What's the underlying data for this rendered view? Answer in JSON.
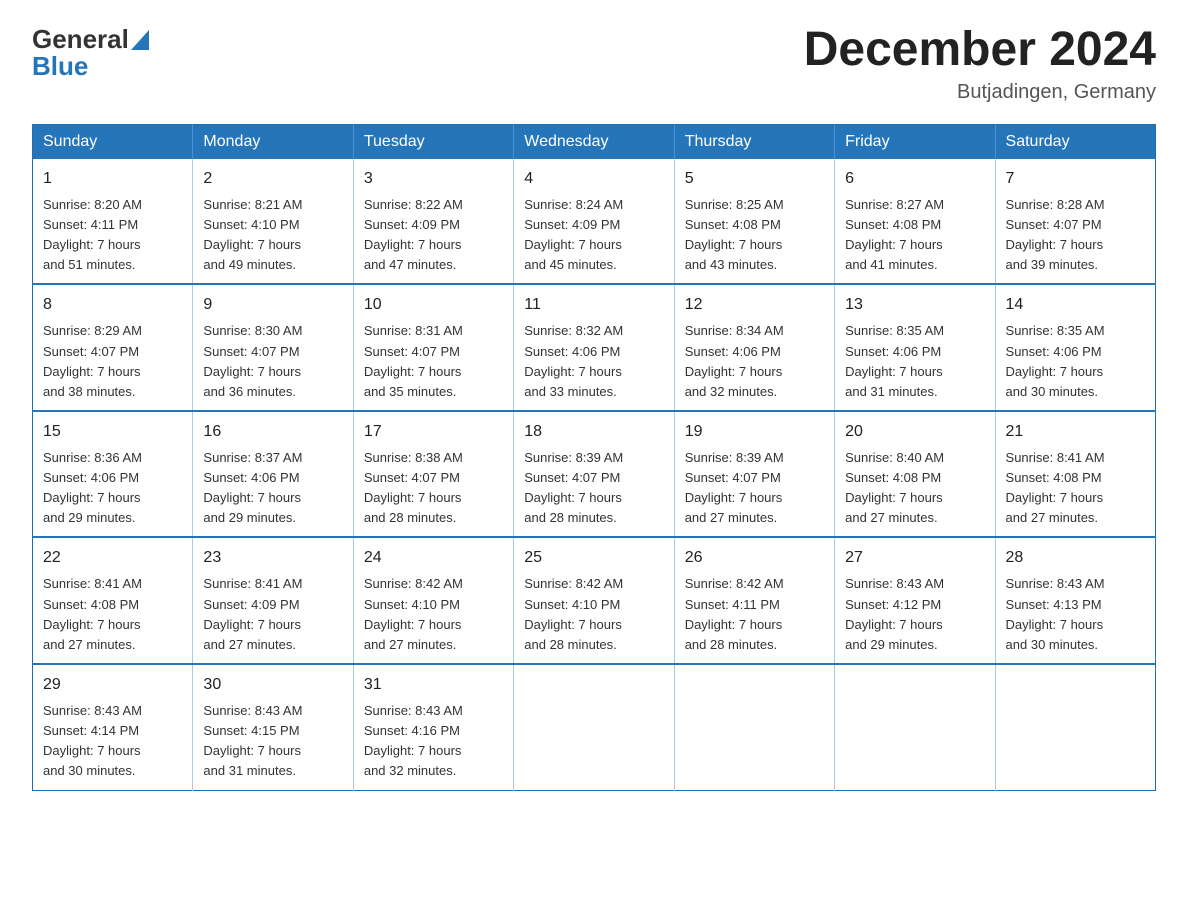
{
  "header": {
    "logo_general": "General",
    "logo_blue": "Blue",
    "month_title": "December 2024",
    "location": "Butjadingen, Germany"
  },
  "weekdays": [
    "Sunday",
    "Monday",
    "Tuesday",
    "Wednesday",
    "Thursday",
    "Friday",
    "Saturday"
  ],
  "weeks": [
    [
      {
        "day": "1",
        "sunrise": "8:20 AM",
        "sunset": "4:11 PM",
        "daylight": "7 hours and 51 minutes."
      },
      {
        "day": "2",
        "sunrise": "8:21 AM",
        "sunset": "4:10 PM",
        "daylight": "7 hours and 49 minutes."
      },
      {
        "day": "3",
        "sunrise": "8:22 AM",
        "sunset": "4:09 PM",
        "daylight": "7 hours and 47 minutes."
      },
      {
        "day": "4",
        "sunrise": "8:24 AM",
        "sunset": "4:09 PM",
        "daylight": "7 hours and 45 minutes."
      },
      {
        "day": "5",
        "sunrise": "8:25 AM",
        "sunset": "4:08 PM",
        "daylight": "7 hours and 43 minutes."
      },
      {
        "day": "6",
        "sunrise": "8:27 AM",
        "sunset": "4:08 PM",
        "daylight": "7 hours and 41 minutes."
      },
      {
        "day": "7",
        "sunrise": "8:28 AM",
        "sunset": "4:07 PM",
        "daylight": "7 hours and 39 minutes."
      }
    ],
    [
      {
        "day": "8",
        "sunrise": "8:29 AM",
        "sunset": "4:07 PM",
        "daylight": "7 hours and 38 minutes."
      },
      {
        "day": "9",
        "sunrise": "8:30 AM",
        "sunset": "4:07 PM",
        "daylight": "7 hours and 36 minutes."
      },
      {
        "day": "10",
        "sunrise": "8:31 AM",
        "sunset": "4:07 PM",
        "daylight": "7 hours and 35 minutes."
      },
      {
        "day": "11",
        "sunrise": "8:32 AM",
        "sunset": "4:06 PM",
        "daylight": "7 hours and 33 minutes."
      },
      {
        "day": "12",
        "sunrise": "8:34 AM",
        "sunset": "4:06 PM",
        "daylight": "7 hours and 32 minutes."
      },
      {
        "day": "13",
        "sunrise": "8:35 AM",
        "sunset": "4:06 PM",
        "daylight": "7 hours and 31 minutes."
      },
      {
        "day": "14",
        "sunrise": "8:35 AM",
        "sunset": "4:06 PM",
        "daylight": "7 hours and 30 minutes."
      }
    ],
    [
      {
        "day": "15",
        "sunrise": "8:36 AM",
        "sunset": "4:06 PM",
        "daylight": "7 hours and 29 minutes."
      },
      {
        "day": "16",
        "sunrise": "8:37 AM",
        "sunset": "4:06 PM",
        "daylight": "7 hours and 29 minutes."
      },
      {
        "day": "17",
        "sunrise": "8:38 AM",
        "sunset": "4:07 PM",
        "daylight": "7 hours and 28 minutes."
      },
      {
        "day": "18",
        "sunrise": "8:39 AM",
        "sunset": "4:07 PM",
        "daylight": "7 hours and 28 minutes."
      },
      {
        "day": "19",
        "sunrise": "8:39 AM",
        "sunset": "4:07 PM",
        "daylight": "7 hours and 27 minutes."
      },
      {
        "day": "20",
        "sunrise": "8:40 AM",
        "sunset": "4:08 PM",
        "daylight": "7 hours and 27 minutes."
      },
      {
        "day": "21",
        "sunrise": "8:41 AM",
        "sunset": "4:08 PM",
        "daylight": "7 hours and 27 minutes."
      }
    ],
    [
      {
        "day": "22",
        "sunrise": "8:41 AM",
        "sunset": "4:08 PM",
        "daylight": "7 hours and 27 minutes."
      },
      {
        "day": "23",
        "sunrise": "8:41 AM",
        "sunset": "4:09 PM",
        "daylight": "7 hours and 27 minutes."
      },
      {
        "day": "24",
        "sunrise": "8:42 AM",
        "sunset": "4:10 PM",
        "daylight": "7 hours and 27 minutes."
      },
      {
        "day": "25",
        "sunrise": "8:42 AM",
        "sunset": "4:10 PM",
        "daylight": "7 hours and 28 minutes."
      },
      {
        "day": "26",
        "sunrise": "8:42 AM",
        "sunset": "4:11 PM",
        "daylight": "7 hours and 28 minutes."
      },
      {
        "day": "27",
        "sunrise": "8:43 AM",
        "sunset": "4:12 PM",
        "daylight": "7 hours and 29 minutes."
      },
      {
        "day": "28",
        "sunrise": "8:43 AM",
        "sunset": "4:13 PM",
        "daylight": "7 hours and 30 minutes."
      }
    ],
    [
      {
        "day": "29",
        "sunrise": "8:43 AM",
        "sunset": "4:14 PM",
        "daylight": "7 hours and 30 minutes."
      },
      {
        "day": "30",
        "sunrise": "8:43 AM",
        "sunset": "4:15 PM",
        "daylight": "7 hours and 31 minutes."
      },
      {
        "day": "31",
        "sunrise": "8:43 AM",
        "sunset": "4:16 PM",
        "daylight": "7 hours and 32 minutes."
      },
      null,
      null,
      null,
      null
    ]
  ],
  "labels": {
    "sunrise": "Sunrise:",
    "sunset": "Sunset:",
    "daylight": "Daylight:"
  }
}
